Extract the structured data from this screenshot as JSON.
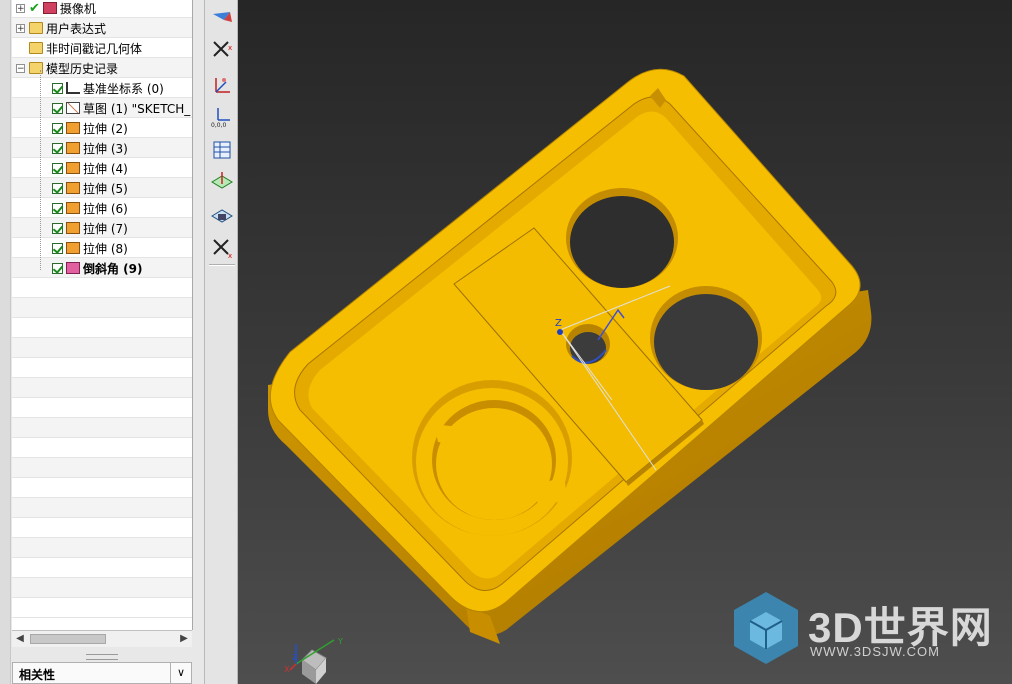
{
  "navigator": {
    "tree": [
      {
        "label": "摄像机",
        "level": 0,
        "expander": "+",
        "state": "tick",
        "icon": "camera-icon"
      },
      {
        "label": "用户表达式",
        "level": 0,
        "expander": "+",
        "state": "none",
        "icon": "folder-icon"
      },
      {
        "label": "非时间戳记几何体",
        "level": 0,
        "expander": "",
        "state": "none",
        "icon": "folder-icon"
      },
      {
        "label": "模型历史记录",
        "level": 0,
        "expander": "-",
        "state": "none",
        "icon": "folder-icon"
      },
      {
        "label": "基准坐标系 (0)",
        "level": 1,
        "state": "check",
        "icon": "datum-csys-icon"
      },
      {
        "label": "草图 (1) \"SKETCH_",
        "level": 1,
        "state": "check",
        "icon": "sketch-icon"
      },
      {
        "label": "拉伸 (2)",
        "level": 1,
        "state": "check",
        "icon": "extrude-icon"
      },
      {
        "label": "拉伸 (3)",
        "level": 1,
        "state": "check",
        "icon": "extrude-icon"
      },
      {
        "label": "拉伸 (4)",
        "level": 1,
        "state": "check",
        "icon": "extrude-icon"
      },
      {
        "label": "拉伸 (5)",
        "level": 1,
        "state": "check",
        "icon": "extrude-icon"
      },
      {
        "label": "拉伸 (6)",
        "level": 1,
        "state": "check",
        "icon": "extrude-icon"
      },
      {
        "label": "拉伸 (7)",
        "level": 1,
        "state": "check",
        "icon": "extrude-icon"
      },
      {
        "label": "拉伸 (8)",
        "level": 1,
        "state": "check",
        "icon": "extrude-icon"
      },
      {
        "label": "倒斜角 (9)",
        "level": 1,
        "state": "check",
        "icon": "chamfer-icon",
        "bold": true
      }
    ],
    "relations_label": "相关性"
  },
  "toolbar": {
    "buttons": [
      "wcs-dynamic-icon",
      "wcs-origin-icon",
      "wcs-rotate-icon",
      "wcs-absolute-icon",
      "wcs-table-icon",
      "wcs-plane-icon",
      "wcs-save-icon",
      "wcs-display-icon"
    ]
  },
  "viewport": {
    "model_color": "#f6be00",
    "background": "#333333",
    "triad_labels": {
      "x": "X",
      "y": "Y",
      "z": "Z"
    },
    "wcs_label": "Z"
  },
  "watermark": {
    "title": "3D世界网",
    "url": "WWW.3DSJW.COM"
  }
}
